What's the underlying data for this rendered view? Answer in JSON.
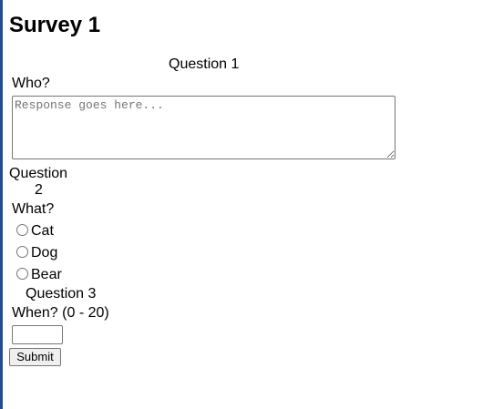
{
  "survey": {
    "title": "Survey 1"
  },
  "q1": {
    "heading": "Question 1",
    "prompt": "Who?",
    "placeholder": "Response goes here...",
    "value": ""
  },
  "q2": {
    "heading_line1": "Question",
    "heading_line2": "2",
    "prompt": "What?",
    "options": [
      {
        "label": "Cat",
        "selected": false
      },
      {
        "label": "Dog",
        "selected": false
      },
      {
        "label": "Bear",
        "selected": false
      }
    ]
  },
  "q3": {
    "heading": "Question 3",
    "prompt": "When? (0 - 20)",
    "value": ""
  },
  "actions": {
    "submit_label": "Submit"
  },
  "colors": {
    "left_bar": "#1f4e8c"
  }
}
